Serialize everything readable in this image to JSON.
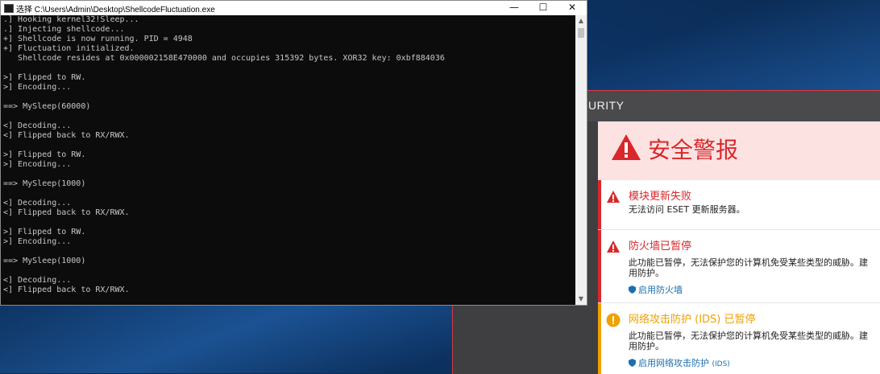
{
  "console": {
    "title": "选择 C:\\Users\\Admin\\Desktop\\ShellcodeFluctuation.exe",
    "controls": {
      "minimize": "—",
      "maximize": "☐",
      "close": "✕"
    },
    "lines": [
      ".] Hooking kernel32!Sleep...",
      ".] Injecting shellcode...",
      "+] Shellcode is now running. PID = 4948",
      "+] Fluctuation initialized.",
      "   Shellcode resides at 0x000002158E470000 and occupies 315392 bytes. XOR32 key: 0xbf884036",
      "",
      ">] Flipped to RW.",
      ">] Encoding...",
      "",
      "==> MySleep(60000)",
      "",
      "<] Decoding...",
      "<] Flipped back to RX/RWX.",
      "",
      ">] Flipped to RW.",
      ">] Encoding...",
      "",
      "==> MySleep(1000)",
      "",
      "<] Decoding...",
      "<] Flipped back to RX/RWX.",
      "",
      ">] Flipped to RW.",
      ">] Encoding...",
      "",
      "==> MySleep(1000)",
      "",
      "<] Decoding...",
      "<] Flipped back to RX/RWX."
    ]
  },
  "eset": {
    "brand_partial": "URITY",
    "alert_title": "安全警报",
    "items": [
      {
        "title": "模块更新失败",
        "lines": [
          "无法访问 ESET 更新服务器。"
        ],
        "link": "",
        "link_suffix": ""
      },
      {
        "title": "防火墙已暂停",
        "lines": [
          "此功能已暂停，无法保护您的计算机免受某些类型的威胁。建",
          "用防护。"
        ],
        "link": "启用防火墙",
        "link_suffix": ""
      },
      {
        "title": "网络攻击防护 (IDS) 已暂停",
        "lines": [
          "此功能已暂停，无法保护您的计算机免受某些类型的威胁。建",
          "用防护。"
        ],
        "link": "启用网络攻击防护",
        "link_suffix": "(IDS)"
      }
    ]
  },
  "colors": {
    "console_bg": "#0c0c0c",
    "alert_red": "#d8282c",
    "warning_orange": "#f0a000",
    "link_blue": "#1a6fb0"
  }
}
